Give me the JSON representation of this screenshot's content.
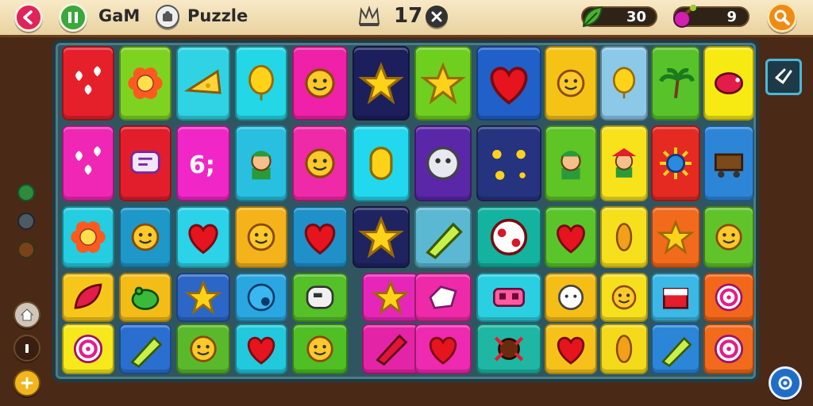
{
  "header": {
    "game_name": "GaM",
    "puzzle_label": "Puzzle",
    "score": "17",
    "coins": "30",
    "gems": "9"
  },
  "icons": {
    "back": "back-arrow-icon",
    "pause": "pause-icon",
    "puzzle": "puzzle-piece-icon",
    "crown": "crown-icon",
    "close": "close-icon",
    "leaf": "leaf-icon",
    "potion": "potion-icon",
    "search": "magnifier-icon",
    "exit": "exit-icon",
    "settings": "settings-icon"
  },
  "board": {
    "rows": [
      [
        "hearts",
        "flower",
        "cheese",
        "balloon",
        "sun-face",
        "star",
        "star",
        "heart",
        "sun-face",
        "balloon",
        "palm",
        "bird"
      ],
      [
        "hearts",
        "chat",
        "letters",
        "boy",
        "sun-face",
        "hand",
        "ghost",
        "stars",
        "boy",
        "girl",
        "sunburst",
        "cart"
      ],
      [
        "flower",
        "sun-face",
        "heart",
        "sun-face",
        "heart",
        "star",
        "crayon",
        "ball",
        "heart",
        "bean",
        "star",
        "sun-face"
      ],
      [
        "leaf",
        "frog",
        "star",
        "bubble",
        "robot",
        "star",
        "box",
        "mask",
        "sheep",
        "sun-face",
        "cake",
        "swirl"
      ],
      [
        "swirl",
        "crayon",
        "sun-face",
        "heart",
        "sun-face",
        "candy",
        "heart",
        "bug",
        "heart",
        "bean",
        "crayon",
        "swirl"
      ]
    ],
    "colors": [
      [
        "#e5202a",
        "#7ed321",
        "#2fd3e3",
        "#23d7e6",
        "#ee21a8",
        "#1c1f5c",
        "#6fcf1f",
        "#2060c8",
        "#f5c316",
        "#8cc8e8",
        "#58c22a",
        "#f6ea12"
      ],
      [
        "#ef27b4",
        "#e21d2c",
        "#f027c6",
        "#28bfe0",
        "#ef2aa8",
        "#22d8ee",
        "#5a27a8",
        "#26337f",
        "#5fc425",
        "#f8e21b",
        "#e52a21",
        "#2d85d8"
      ],
      [
        "#24cde0",
        "#1e97c9",
        "#2bd2e8",
        "#f4b31a",
        "#1f90c8",
        "#1f2461",
        "#5bb8d2",
        "#13b3a0",
        "#59c52a",
        "#f6df1c",
        "#f26a1c",
        "#61c32a"
      ],
      [
        "#f6c71a",
        "#f4bc16",
        "#2c66c6",
        "#2aa6e0",
        "#55c028",
        "#e626b8",
        "#ee2aa9",
        "#2ad0e2",
        "#f4be17",
        "#f6df1c",
        "#3bb8e6",
        "#f26719"
      ],
      [
        "#f6e81b",
        "#2a6fd0",
        "#5ab92a",
        "#22c8dc",
        "#4fbf24",
        "#e424a6",
        "#ee2ab0",
        "#1fb6a4",
        "#f6c21a",
        "#f4da1a",
        "#2b86d8",
        "#f26a1b"
      ]
    ]
  }
}
